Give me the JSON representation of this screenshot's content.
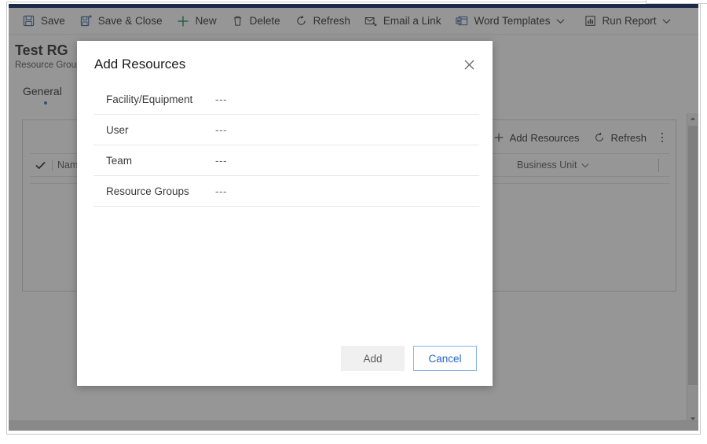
{
  "command_bar": {
    "items": [
      {
        "label": "Save",
        "icon": "save-icon",
        "has_chevron": false
      },
      {
        "label": "Save & Close",
        "icon": "save-and-close-icon",
        "has_chevron": false
      },
      {
        "label": "New",
        "icon": "plus-icon",
        "has_chevron": false
      },
      {
        "label": "Delete",
        "icon": "trash-icon",
        "has_chevron": false
      },
      {
        "label": "Refresh",
        "icon": "refresh-icon",
        "has_chevron": false
      },
      {
        "label": "Email a Link",
        "icon": "email-link-icon",
        "has_chevron": false
      },
      {
        "label": "Word Templates",
        "icon": "word-template-icon",
        "has_chevron": true
      },
      {
        "label": "Run Report",
        "icon": "report-icon",
        "has_chevron": true
      }
    ]
  },
  "record": {
    "title": "Test RG",
    "subtitle": "Resource Group"
  },
  "tabs": [
    {
      "label": "General",
      "selected": true
    }
  ],
  "grid": {
    "toolbar": [
      {
        "label": "Add Resources",
        "icon": "add-resources-icon"
      },
      {
        "label": "Refresh",
        "icon": "refresh-icon"
      }
    ],
    "overflow_icon": "more-vertical-icon",
    "select_all_icon": "checkmark-icon",
    "columns": [
      {
        "label": "Name",
        "sort_icon": "chevron-down-icon"
      },
      {
        "label": "Business Unit",
        "sort_icon": "chevron-down-icon"
      }
    ]
  },
  "scrollbar": {
    "up_icon": "chevron-up-icon",
    "down_icon": "chevron-down-icon"
  },
  "dialog": {
    "title": "Add Resources",
    "close_icon": "close-icon",
    "rows": [
      {
        "label": "Facility/Equipment",
        "value": "---"
      },
      {
        "label": "User",
        "value": "---"
      },
      {
        "label": "Team",
        "value": "---"
      },
      {
        "label": "Resource Groups",
        "value": "---"
      }
    ],
    "buttons": {
      "add": "Add",
      "cancel": "Cancel"
    }
  },
  "colors": {
    "accent_blue": "#2266cc",
    "top_strip_navy": "#1b2a4a",
    "plus_green": "#107c41",
    "overlay_dim": "#404040"
  }
}
